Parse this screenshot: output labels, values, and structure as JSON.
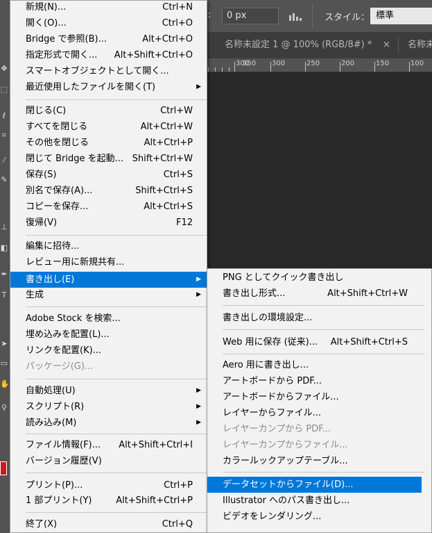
{
  "toolbar_icons": [
    "move-tool-icon",
    "marquee-tool-icon",
    "lasso-tool-icon",
    "crop-tool-icon",
    "eyedropper-tool-icon",
    "brush-tool-icon",
    "stamp-tool-icon",
    "eraser-tool-icon",
    "pen-tool-icon",
    "type-tool-icon",
    "path-selection-tool-icon",
    "rectangle-tool-icon",
    "hand-tool-icon",
    "zoom-tool-icon"
  ],
  "options_bar": {
    "feather_value": "0 px",
    "style_label": "スタイル：",
    "style_value": "標準"
  },
  "document_tabs": [
    {
      "title": "名称未設定 1 @ 100% (RGB/8#) *",
      "close": "×"
    },
    {
      "title": "名称未"
    }
  ],
  "ruler_labels": [
    "300",
    "350",
    "250",
    "200",
    "150",
    "100"
  ],
  "file_menu": {
    "items": [
      {
        "label": "新規(N)...",
        "shortcut": "Ctrl+N"
      },
      {
        "label": "開く(O)...",
        "shortcut": "Ctrl+O"
      },
      {
        "label": "Bridge で参照(B)...",
        "shortcut": "Alt+Ctrl+O"
      },
      {
        "label": "指定形式で開く...",
        "shortcut": "Alt+Shift+Ctrl+O"
      },
      {
        "label": "スマートオブジェクトとして開く...",
        "shortcut": ""
      },
      {
        "label": "最近使用したファイルを開く(T)",
        "shortcut": "",
        "submenu": true
      },
      {
        "label": "閉じる(C)",
        "shortcut": "Ctrl+W"
      },
      {
        "label": "すべてを閉じる",
        "shortcut": "Alt+Ctrl+W"
      },
      {
        "label": "その他を閉じる",
        "shortcut": "Alt+Ctrl+P"
      },
      {
        "label": "閉じて Bridge を起動...",
        "shortcut": "Shift+Ctrl+W"
      },
      {
        "label": "保存(S)",
        "shortcut": "Ctrl+S"
      },
      {
        "label": "別名で保存(A)...",
        "shortcut": "Shift+Ctrl+S"
      },
      {
        "label": "コピーを保存...",
        "shortcut": "Alt+Ctrl+S"
      },
      {
        "label": "復帰(V)",
        "shortcut": "F12"
      },
      {
        "label": "編集に招待...",
        "shortcut": ""
      },
      {
        "label": "レビュー用に新規共有...",
        "shortcut": ""
      },
      {
        "label": "書き出し(E)",
        "shortcut": "",
        "submenu": true,
        "highlighted": true
      },
      {
        "label": "生成",
        "shortcut": "",
        "submenu": true
      },
      {
        "label": "Adobe Stock を検索...",
        "shortcut": ""
      },
      {
        "label": "埋め込みを配置(L)...",
        "shortcut": ""
      },
      {
        "label": "リンクを配置(K)...",
        "shortcut": ""
      },
      {
        "label": "パッケージ(G)...",
        "shortcut": "",
        "disabled": true
      },
      {
        "label": "自動処理(U)",
        "shortcut": "",
        "submenu": true
      },
      {
        "label": "スクリプト(R)",
        "shortcut": "",
        "submenu": true
      },
      {
        "label": "読み込み(M)",
        "shortcut": "",
        "submenu": true
      },
      {
        "label": "ファイル情報(F)...",
        "shortcut": "Alt+Shift+Ctrl+I"
      },
      {
        "label": "バージョン履歴(V)",
        "shortcut": ""
      },
      {
        "label": "プリント(P)...",
        "shortcut": "Ctrl+P"
      },
      {
        "label": "1 部プリント(Y)",
        "shortcut": "Alt+Shift+Ctrl+P"
      },
      {
        "label": "終了(X)",
        "shortcut": "Ctrl+Q"
      }
    ],
    "submenu_arrow": "▶"
  },
  "export_menu": {
    "items": [
      {
        "label": "PNG としてクイック書き出し",
        "shortcut": ""
      },
      {
        "label": "書き出し形式...",
        "shortcut": "Alt+Shift+Ctrl+W"
      },
      {
        "label": "書き出しの環境設定...",
        "shortcut": ""
      },
      {
        "label": "Web 用に保存 (従来)...",
        "shortcut": "Alt+Shift+Ctrl+S"
      },
      {
        "label": "Aero 用に書き出し...",
        "shortcut": ""
      },
      {
        "label": "アートボードから PDF...",
        "shortcut": ""
      },
      {
        "label": "アートボードからファイル...",
        "shortcut": ""
      },
      {
        "label": "レイヤーからファイル...",
        "shortcut": ""
      },
      {
        "label": "レイヤーカンプから PDF...",
        "shortcut": "",
        "disabled": true
      },
      {
        "label": "レイヤーカンプからファイル...",
        "shortcut": "",
        "disabled": true
      },
      {
        "label": "カラールックアップテーブル...",
        "shortcut": ""
      },
      {
        "label": "データセットからファイル(D)...",
        "shortcut": "",
        "highlighted": true
      },
      {
        "label": "Illustrator へのパス書き出し...",
        "shortcut": ""
      },
      {
        "label": "ビデオをレンダリング...",
        "shortcut": ""
      }
    ]
  },
  "colors": {
    "highlight": "#0078d7",
    "menu_bg": "#f2f2f2",
    "workspace_bg": "#282828",
    "panel_bg": "#535353"
  }
}
